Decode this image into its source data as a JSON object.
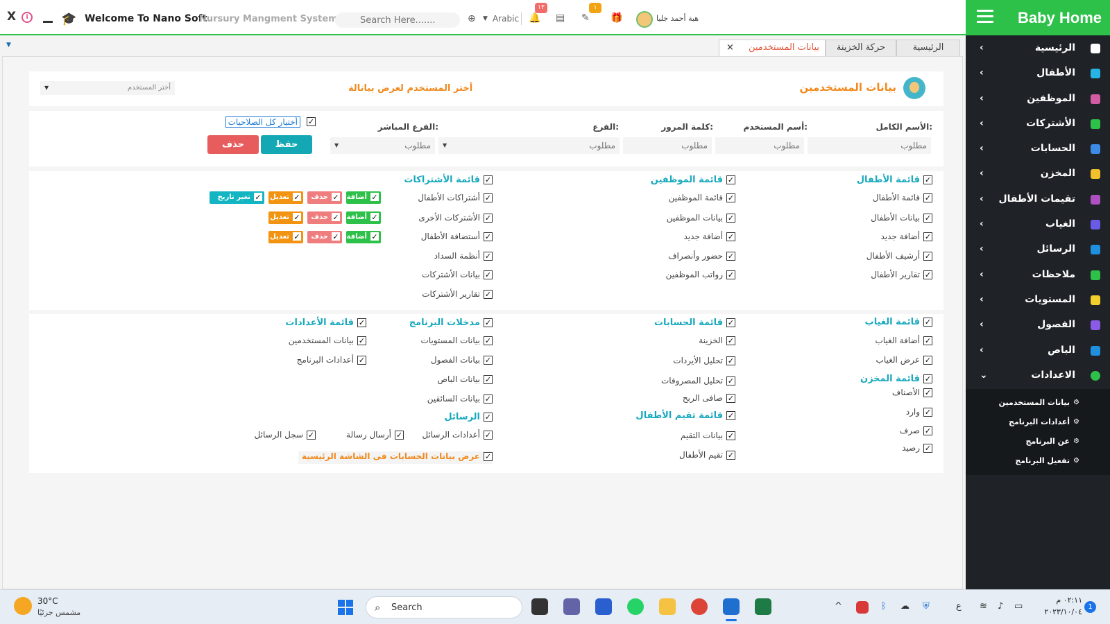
{
  "topbar": {
    "close_label": "X",
    "welcome": "Welcome To Nano Soft",
    "system_name": "Nursury Mangment System",
    "search_placeholder": "Search Here.......",
    "language": "Arabic",
    "notif_badge": "١٣",
    "chat_badge": "١",
    "user_name": "هبة أحمد جليا",
    "colors": {
      "accent": "#2ec14a",
      "badge_red": "#f26b6b",
      "badge_yellow": "#f2a311"
    }
  },
  "sidebar": {
    "title": "Baby Home",
    "items": [
      {
        "label": "الرئيسية",
        "icon": "home-icon"
      },
      {
        "label": "الأطفال",
        "icon": "child-icon"
      },
      {
        "label": "الموظفين",
        "icon": "employee-icon"
      },
      {
        "label": "الأشتركات",
        "icon": "tag-icon"
      },
      {
        "label": "الحسابات",
        "icon": "chart-icon"
      },
      {
        "label": "المخزن",
        "icon": "store-icon"
      },
      {
        "label": "تقيمات الأطفال",
        "icon": "rating-icon"
      },
      {
        "label": "الغياب",
        "icon": "absence-icon"
      },
      {
        "label": "الرسائل",
        "icon": "mail-icon"
      },
      {
        "label": "ملاحظات",
        "icon": "note-icon"
      },
      {
        "label": "المستويات",
        "icon": "level-icon"
      },
      {
        "label": "الفصول",
        "icon": "class-icon"
      },
      {
        "label": "الباص",
        "icon": "bus-icon"
      },
      {
        "label": "الاعدادات",
        "icon": "settings-icon"
      }
    ],
    "subitems": [
      {
        "label": "بيانات المستخدمين"
      },
      {
        "label": "أعدادات البرنامج"
      },
      {
        "label": "عن البرنامج"
      },
      {
        "label": "تفعيل البرنامج"
      }
    ]
  },
  "tabs": [
    {
      "label": "الرئيسية"
    },
    {
      "label": "حركة الخزينة"
    },
    {
      "label": "بيانات المستخدمين"
    }
  ],
  "header": {
    "title": "بيانات المستخدمين",
    "choose_prompt": "أختر المستخدم لعرض بيانالة",
    "user_select": "أختر المستخدم"
  },
  "form": {
    "full_name_label": "الأسم الكامل:",
    "username_label": "أسم المستخدم:",
    "password_label": "كلمة المرور:",
    "branch_label": "الفرع:",
    "direct_branch_label": "الفرع المباشر:",
    "required": "مطلوب",
    "select_all": "أختيار كل الصلاحيات",
    "save": "حفظ",
    "delete": "حذف"
  },
  "perm1": {
    "children": {
      "header": "قائمة الأطفال",
      "items": [
        "قائمة الأطفال",
        "بيانات الأطفال",
        "أضافة جديد",
        "أرشيف الأطفال",
        "تقارير الأطفال"
      ]
    },
    "employees": {
      "header": "قائمة الموظفين",
      "items": [
        "قائمة الموظفين",
        "بيانات الموظفين",
        "أضافة جديد",
        "حضور وأنصراف",
        "رواتب الموظفين"
      ]
    },
    "subscriptions": {
      "header": "قائمة الأشتراكات",
      "items": [
        "أشتراكات الأطفال",
        "الأشتركات الأخرى",
        "أستضافة الأطفال",
        "أنظمة السداد",
        "بيانات الأشتركات",
        "تقارير الأشتركات"
      ]
    },
    "chips": {
      "add": "أضافة",
      "delete": "حذف",
      "edit": "تعديل",
      "change_date": "تغير تاريخ"
    }
  },
  "perm2": {
    "absence": {
      "header": "قائمة الغياب",
      "items": [
        "أضافة الغياب",
        "عرض الغياب"
      ]
    },
    "store": {
      "header": "قائمة المخزن",
      "items": [
        "الأصناف",
        "وارد",
        "صرف",
        "رصيد"
      ]
    },
    "accounts": {
      "header": "قائمة الحسابات",
      "items": [
        "الخزينة",
        "تحليل الأيردات",
        "تحليل المصروفات",
        "صافى الربح"
      ]
    },
    "ratings": {
      "header": "قائمة تقيم الأطفال",
      "items": [
        "بيانات التقيم",
        "تقيم الأطفال"
      ]
    },
    "inputs": {
      "header": "مدخلات البرنامج",
      "items": [
        "بيانات المستويات",
        "بيانات الفصول",
        "بيانات الباص",
        "بيانات السائقين"
      ]
    },
    "messages": {
      "header": "الرسائل",
      "items": [
        "أعدادات الرسائل",
        "أرسال رسالة",
        "سجل الرسائل"
      ]
    },
    "settings": {
      "header": "قائمة الأعدادات",
      "items": [
        "بيانات المستخدمين",
        "أعدادات البرنامج"
      ]
    },
    "dashboard_option": "عرض بيانات الحسابات فى الشاشة الرئيسية"
  },
  "taskbar": {
    "temperature": "30°C",
    "weather": "مشمس جزئيًا",
    "search": "Search",
    "time": "٠٢:١١ م",
    "date": "٢٠٢٣/١٠/٠٤",
    "notif_count": "1",
    "lang": "ع"
  }
}
